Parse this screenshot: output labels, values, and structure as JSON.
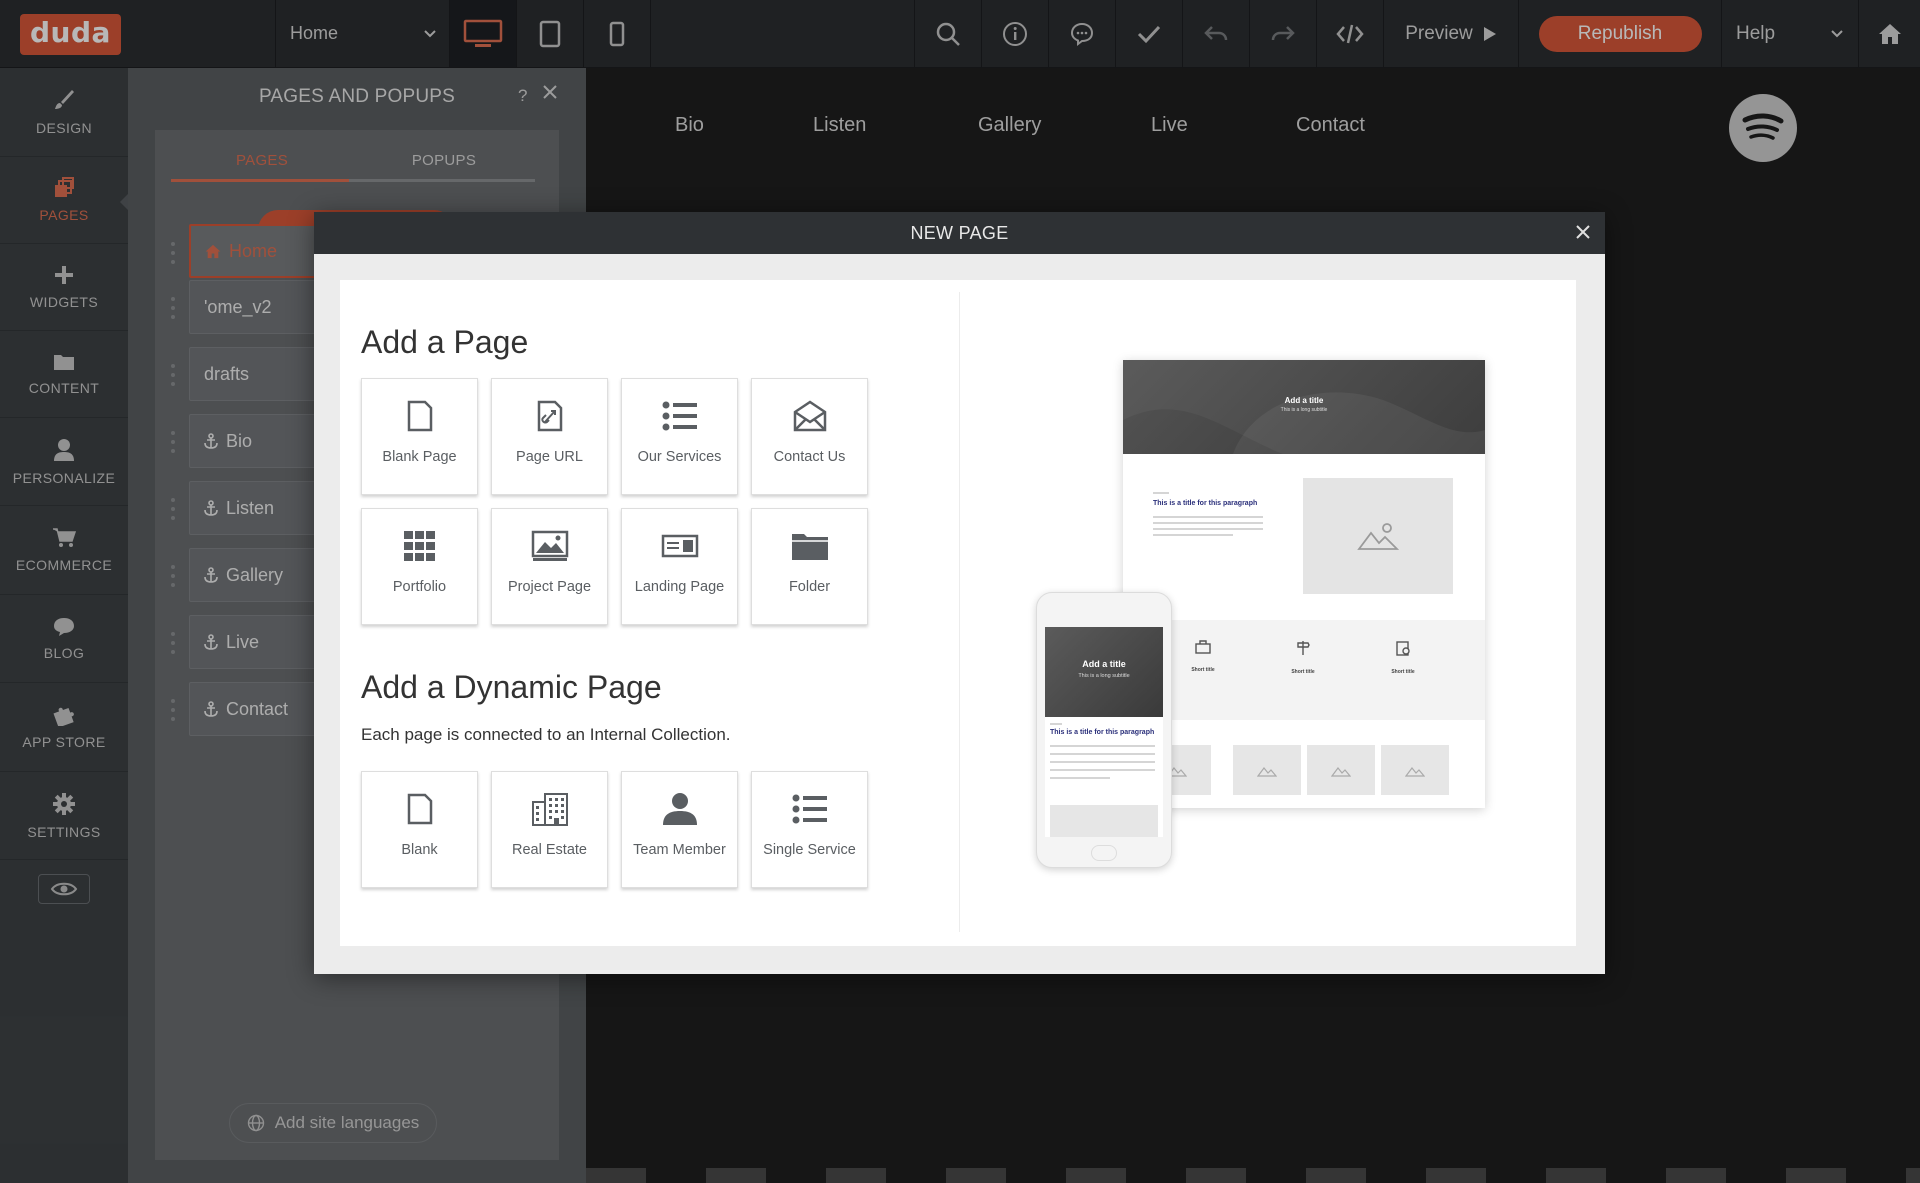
{
  "topbar": {
    "logo": "duda",
    "page_select": "Home",
    "preview_label": "Preview",
    "republish_label": "Republish",
    "help_label": "Help"
  },
  "leftnav": {
    "items": [
      {
        "label": "DESIGN",
        "icon": "brush-icon"
      },
      {
        "label": "PAGES",
        "icon": "pages-icon",
        "active": true
      },
      {
        "label": "WIDGETS",
        "icon": "plus-icon"
      },
      {
        "label": "CONTENT",
        "icon": "folder-icon"
      },
      {
        "label": "PERSONALIZE",
        "icon": "person-icon"
      },
      {
        "label": "ECOMMERCE",
        "icon": "cart-icon"
      },
      {
        "label": "BLOG",
        "icon": "chat-icon"
      },
      {
        "label": "APP STORE",
        "icon": "puzzle-icon"
      },
      {
        "label": "SETTINGS",
        "icon": "gear-icon"
      }
    ]
  },
  "panel": {
    "title": "PAGES AND POPUPS",
    "help": "?",
    "tabs": {
      "pages": "PAGES",
      "popups": "POPUPS"
    },
    "pages": [
      {
        "label": "Home",
        "icon": "home-icon",
        "selected": true
      },
      {
        "label": "'ome_v2",
        "icon": ""
      },
      {
        "label": "drafts",
        "icon": ""
      },
      {
        "label": "Bio",
        "icon": "anchor-icon"
      },
      {
        "label": "Listen",
        "icon": "anchor-icon"
      },
      {
        "label": "Gallery",
        "icon": "anchor-icon"
      },
      {
        "label": "Live",
        "icon": "anchor-icon"
      },
      {
        "label": "Contact",
        "icon": "anchor-icon"
      }
    ],
    "lang_button": "Add site languages"
  },
  "site": {
    "nav": [
      "Bio",
      "Listen",
      "Gallery",
      "Live",
      "Contact"
    ]
  },
  "modal": {
    "title": "NEW PAGE",
    "add_page_title": "Add a Page",
    "page_types": [
      "Blank Page",
      "Page URL",
      "Our Services",
      "Contact Us",
      "Portfolio",
      "Project Page",
      "Landing Page",
      "Folder"
    ],
    "dynamic_title": "Add a Dynamic Page",
    "dynamic_subtitle": "Each page is connected to an Internal Collection.",
    "dynamic_types": [
      "Blank",
      "Real Estate",
      "Team Member",
      "Single Service"
    ],
    "preview": {
      "hero_title": "Add a title",
      "hero_subtitle": "This is a long subtitle",
      "paragraph_title": "This is a title for this paragraph",
      "feature_title": "Short title"
    }
  },
  "colors": {
    "accent": "#d9583a",
    "topbar": "#2b2e31",
    "sidebar": "#3e4245",
    "panel": "#5b5f62"
  }
}
